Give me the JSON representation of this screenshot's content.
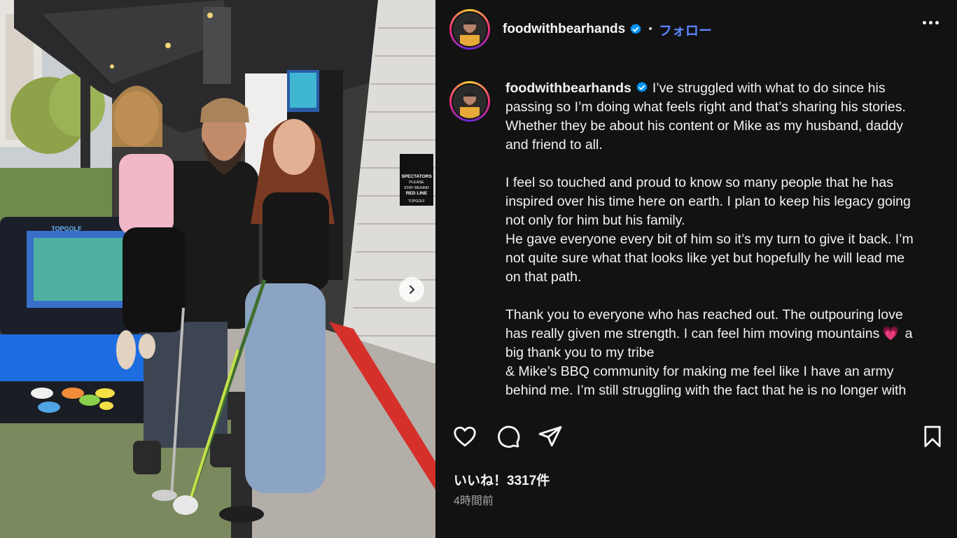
{
  "post": {
    "username": "foodwithbearhands",
    "separator": "•",
    "follow_label": "フォロー",
    "verified_color": "#0095f6",
    "accent_color": "#5b86ff"
  },
  "caption": {
    "username": "foodwithbearhands",
    "lines": [
      "I’ve struggled with what to do since his",
      "passing so I’m doing what feels right and that’s sharing his stories.",
      "Whether they be about his content or Mike as my husband, daddy",
      "and friend to all.",
      "",
      "I feel so touched and proud to know so many people that he has",
      "inspired over his time here on earth. I plan to keep his legacy going",
      "not only for him but his family.",
      "He gave everyone every bit of him so it’s my turn to give it back. I’m",
      "not quite sure what that looks like yet but hopefully he will lead me",
      "on that path.",
      "",
      "Thank you to everyone who has reached out. The outpouring love",
      "has really given me strength. I can feel him moving mountains",
      "a",
      "big thank you to my tribe",
      "& Mike’s BBQ community for making me feel like I have an army",
      "behind me. I’m still struggling with the fact that he is no longer with"
    ],
    "heart_emoji": "💗"
  },
  "actions": {
    "like_icon": "heart-icon",
    "comment_icon": "comment-icon",
    "share_icon": "send-icon",
    "save_icon": "bookmark-icon"
  },
  "likes_text": "いいね！3317件",
  "time_text": "4時間前",
  "photo": {
    "sign_lines": [
      "SPECTATORS",
      "PLEASE",
      "STAY BEHIND",
      "RED LINE"
    ],
    "sign_brand": "TOPGOLF",
    "kiosk_brand": "TOPGOLF"
  }
}
